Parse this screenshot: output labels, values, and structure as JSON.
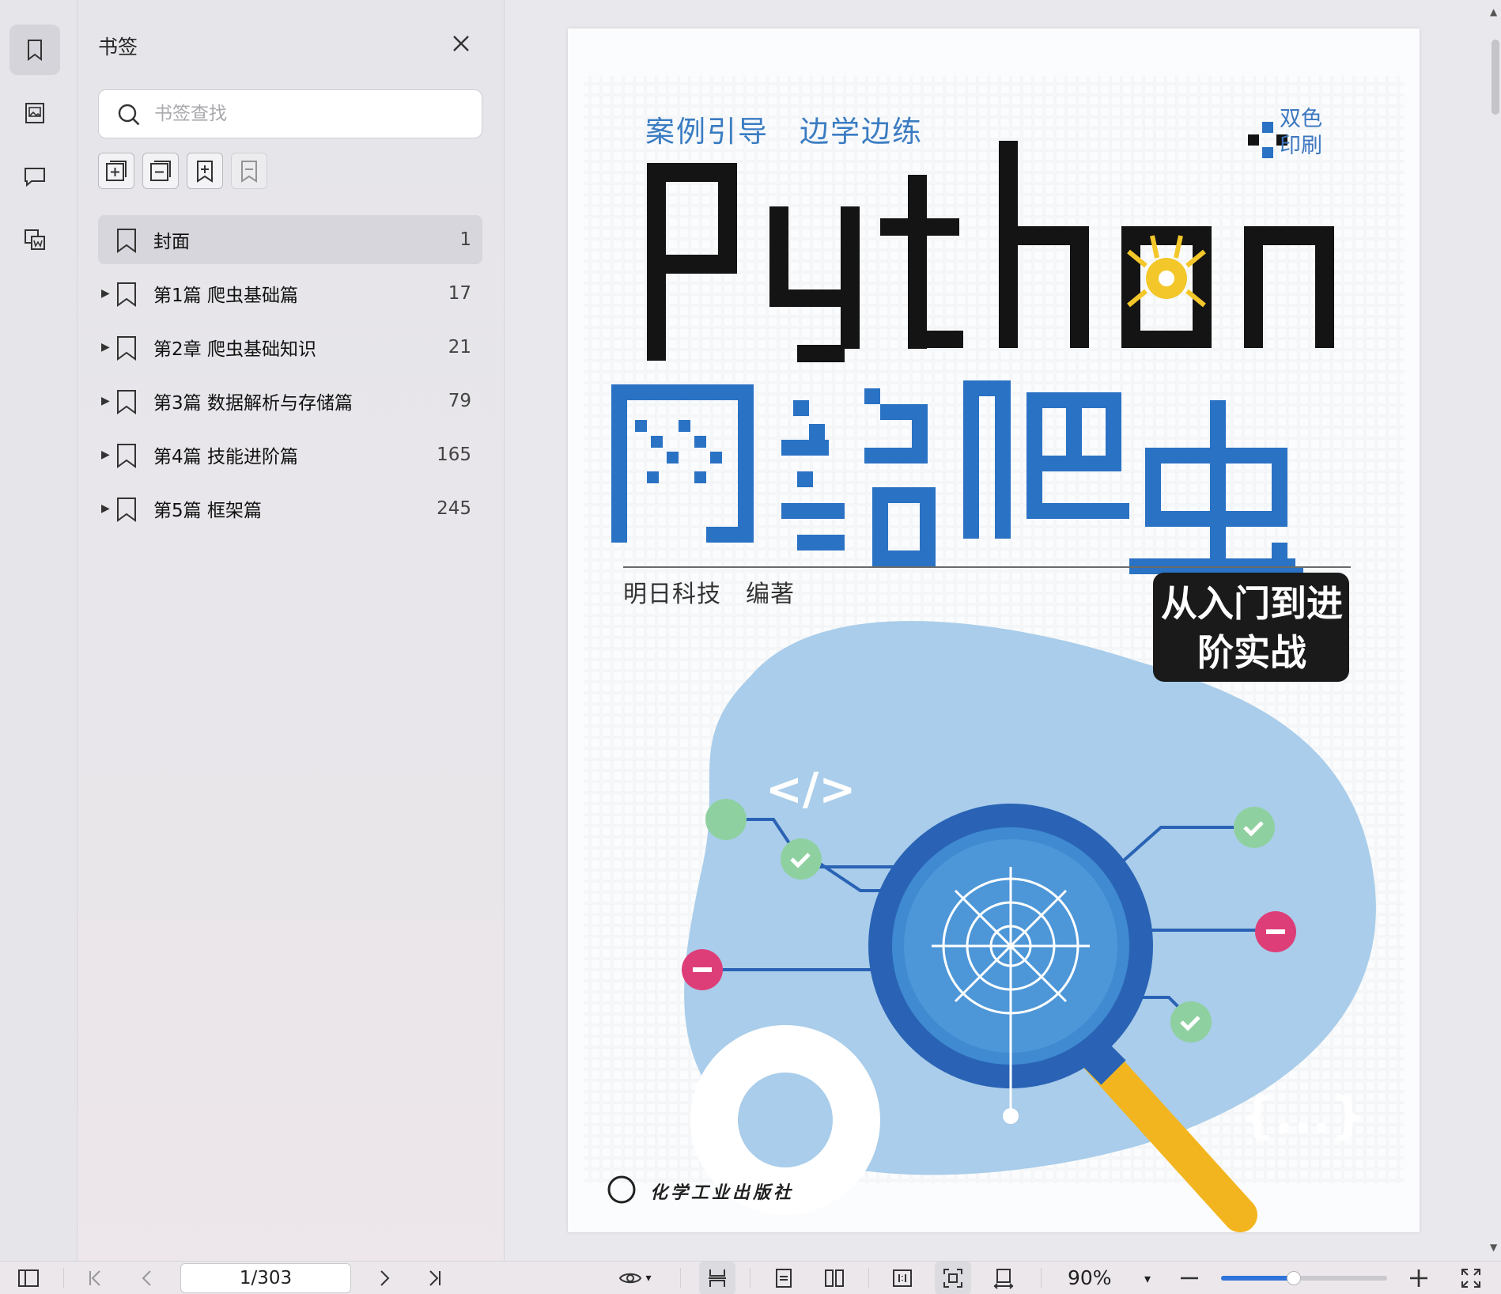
{
  "sidebar_panel": {
    "title": "书签",
    "search_placeholder": "书签查找",
    "tools": [
      "expand-all",
      "collapse-all",
      "add-bookmark",
      "remove-bookmark"
    ],
    "bookmarks": [
      {
        "label": "封面",
        "page": "1",
        "expandable": false,
        "selected": true
      },
      {
        "label": "第1篇 爬虫基础篇",
        "page": "17",
        "expandable": true
      },
      {
        "label": "第2章 爬虫基础知识",
        "page": "21",
        "expandable": true
      },
      {
        "label": "第3篇 数据解析与存储篇",
        "page": "79",
        "expandable": true
      },
      {
        "label": "第4篇 技能进阶篇",
        "page": "165",
        "expandable": true
      },
      {
        "label": "第5篇 框架篇",
        "page": "245",
        "expandable": true
      }
    ]
  },
  "rail": {
    "items": [
      "bookmark-icon",
      "thumbnail-icon",
      "comment-icon",
      "attachment-icon"
    ],
    "active": "bookmark-icon"
  },
  "cover": {
    "slogan": "案例引导　边学边练",
    "print_badge": "双色印刷",
    "title_latin": "Python",
    "title_cjk": "网络爬虫",
    "author": "明日科技　编著",
    "subtitle": "从入门到进阶实战",
    "code_tag": "</>",
    "brace_tag": "{...}",
    "publisher": "化学工业出版社"
  },
  "statusbar": {
    "page_indicator": "1/303",
    "zoom": "90%",
    "zoom_fraction": 0.44
  },
  "colors": {
    "accent": "#2f74d8",
    "cover_blue": "#2a72c4",
    "cover_light_blue": "#a9cdea",
    "magnifier_yellow": "#f3b51f",
    "check_green": "#8fd0a0",
    "minus_pink": "#de3e78"
  }
}
